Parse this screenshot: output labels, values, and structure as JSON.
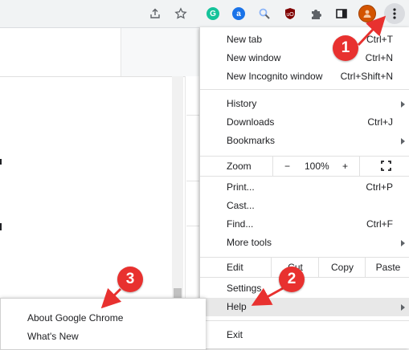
{
  "menu": {
    "group1": [
      {
        "label": "New tab",
        "shortcut": "Ctrl+T"
      },
      {
        "label": "New window",
        "shortcut": "Ctrl+N"
      },
      {
        "label": "New Incognito window",
        "shortcut": "Ctrl+Shift+N"
      }
    ],
    "group2": [
      {
        "label": "History",
        "shortcut": ""
      },
      {
        "label": "Downloads",
        "shortcut": "Ctrl+J"
      },
      {
        "label": "Bookmarks",
        "shortcut": ""
      }
    ],
    "zoom": {
      "label": "Zoom",
      "minus": "−",
      "level": "100%",
      "plus": "+"
    },
    "group3": [
      {
        "label": "Print...",
        "shortcut": "Ctrl+P"
      },
      {
        "label": "Cast...",
        "shortcut": ""
      },
      {
        "label": "Find...",
        "shortcut": "Ctrl+F"
      },
      {
        "label": "More tools",
        "shortcut": ""
      }
    ],
    "edit": {
      "label": "Edit",
      "cut": "Cut",
      "copy": "Copy",
      "paste": "Paste"
    },
    "group4": [
      {
        "label": "Settings",
        "shortcut": ""
      },
      {
        "label": "Help",
        "shortcut": ""
      }
    ],
    "exit": "Exit"
  },
  "help_submenu": {
    "items": [
      "About Google Chrome",
      "What's New"
    ]
  },
  "callouts": [
    "1",
    "2",
    "3"
  ],
  "colors": {
    "callout": "#e8312f",
    "grammarly": "#15c39a",
    "ublock": "#800000",
    "avatar": "#d35400"
  }
}
